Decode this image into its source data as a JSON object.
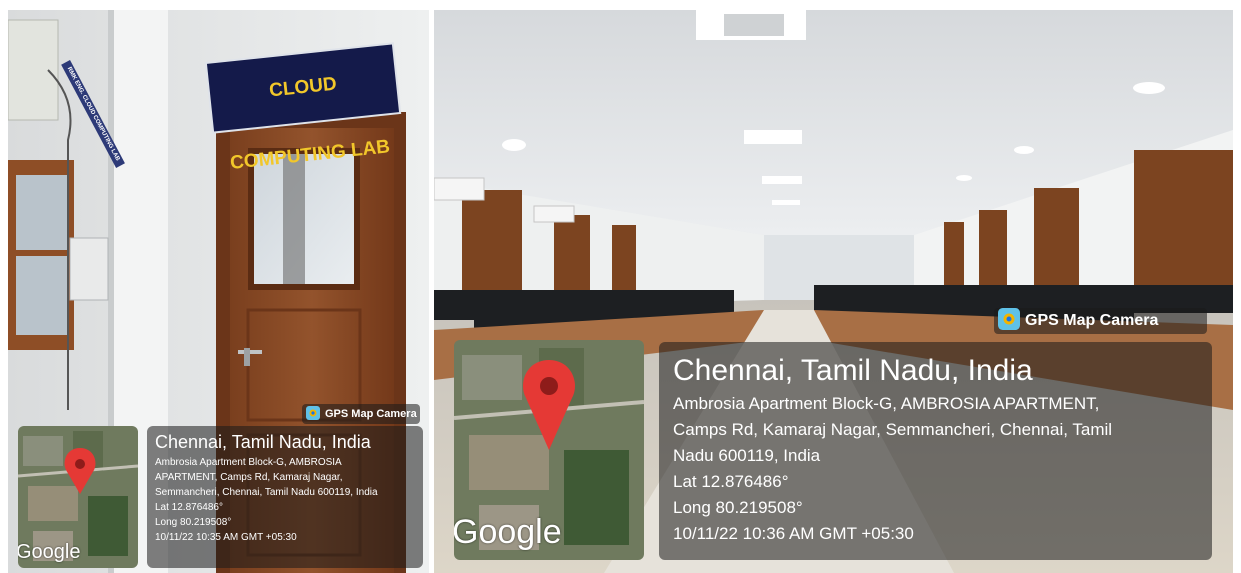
{
  "left_photo": {
    "door_sign": "CLOUD COMPUTING LAB",
    "street_sign": "RMK ENG. CLOUD COMPUTING LAB",
    "badge": "GPS Map Camera",
    "map_logo": "Google",
    "city": "Chennai, Tamil Nadu, India",
    "address_lines": [
      "Ambrosia Apartment Block-G, AMBROSIA",
      "APARTMENT, Camps Rd, Kamaraj Nagar,",
      "Semmancheri, Chennai, Tamil Nadu 600119, India"
    ],
    "lat": "Lat 12.876486°",
    "long": "Long 80.219508°",
    "datetime": "10/11/22 10:35 AM GMT +05:30"
  },
  "right_photo": {
    "badge": "GPS Map Camera",
    "map_logo": "Google",
    "city": "Chennai, Tamil Nadu, India",
    "address_lines": [
      "Ambrosia Apartment Block-G, AMBROSIA APARTMENT,",
      "Camps Rd, Kamaraj Nagar, Semmancheri, Chennai, Tamil",
      "Nadu 600119, India"
    ],
    "lat": "Lat 12.876486°",
    "long": "Long 80.219508°",
    "datetime": "10/11/22 10:36 AM GMT +05:30"
  },
  "colors": {
    "pin_red": "#e53935",
    "sign_navy": "#141a4a",
    "sign_yellow": "#f2c72a",
    "door_brown": "#8a4a24",
    "overlay": "rgba(25,25,25,0.55)"
  },
  "icons": [
    "gps-camera-icon",
    "map-pin-icon"
  ]
}
